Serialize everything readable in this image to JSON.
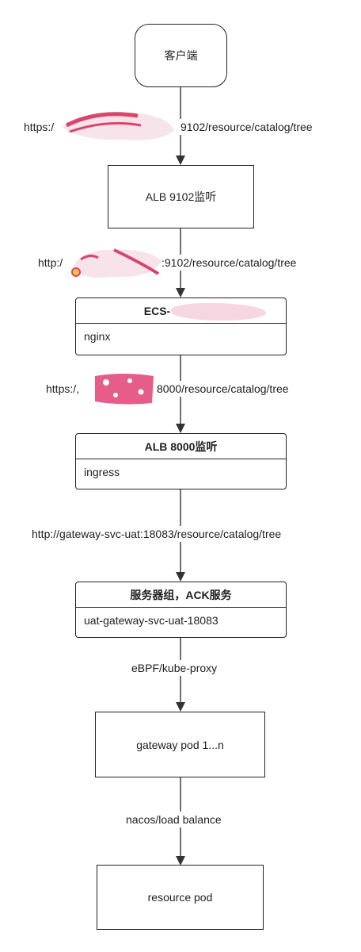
{
  "nodes": {
    "client": "客户端",
    "alb9102": "ALB 9102监听",
    "ecs_header": "ECS-",
    "ecs_body": "nginx",
    "alb8000_header": "ALB 8000监听",
    "alb8000_body": "ingress",
    "group_header": "服务器组，ACK服务",
    "group_body": "uat-gateway-svc-uat-18083",
    "gateway_pod": "gateway pod 1...n",
    "resource_pod": "resource pod"
  },
  "edges": {
    "e1_prefix": "https:/",
    "e1_suffix": "9102/resource/catalog/tree",
    "e2_prefix": "http:/",
    "e2_suffix": ":9102/resource/catalog/tree",
    "e3_prefix": "https:/,",
    "e3_suffix": "8000/resource/catalog/tree",
    "e4": "http://gateway-svc-uat:18083/resource/catalog/tree",
    "e5": "eBPF/kube-proxy",
    "e6": "nacos/load balance"
  },
  "colors": {
    "line": "#333333",
    "redaction_pink": "#e0507a",
    "redaction_light": "#f7e4ea"
  }
}
